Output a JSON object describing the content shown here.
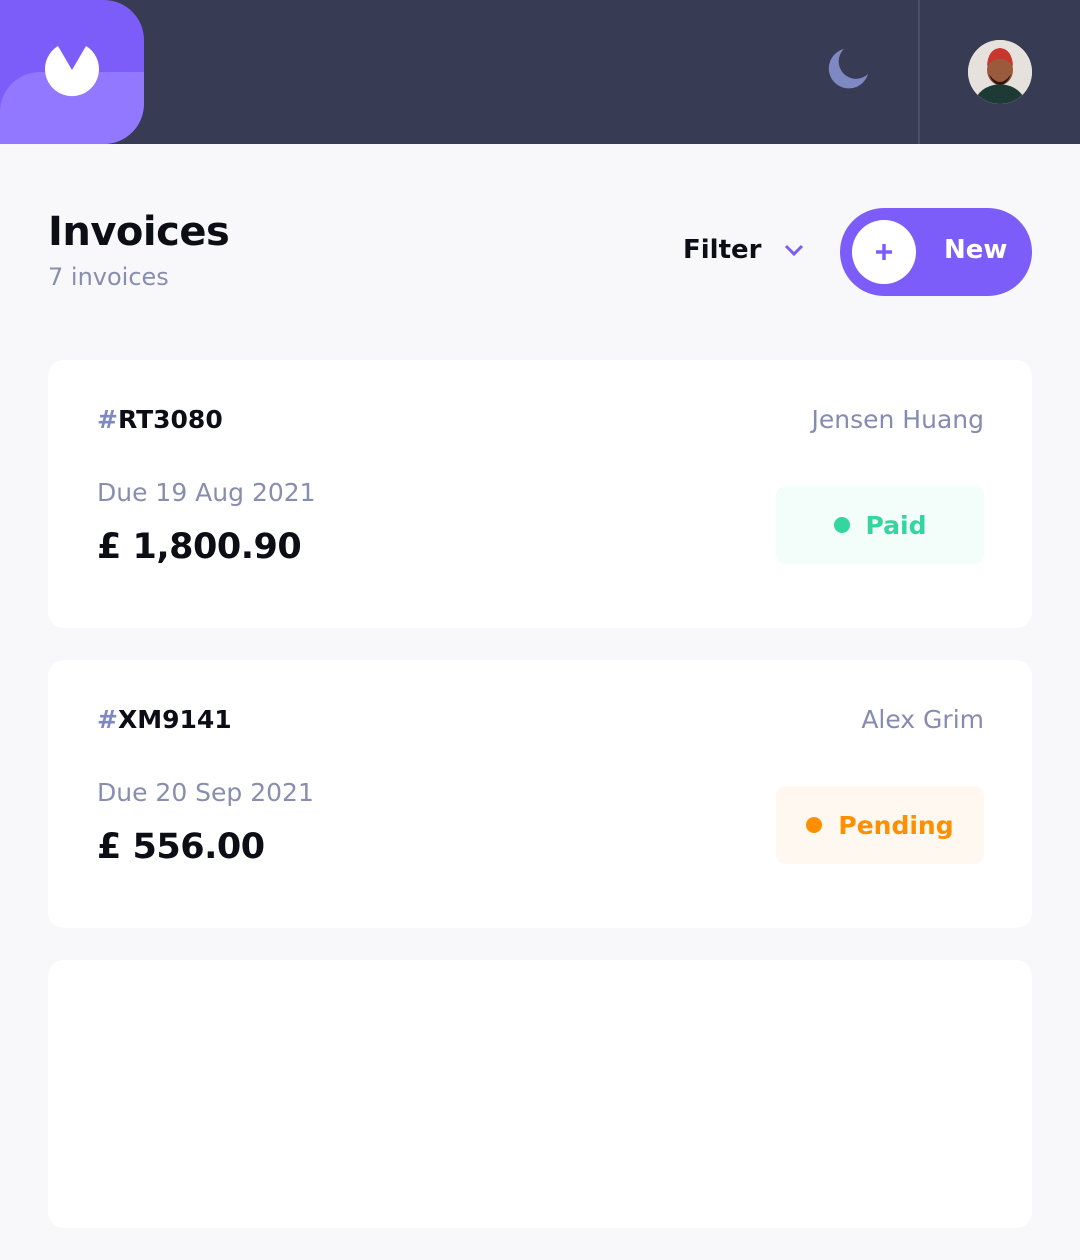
{
  "header": {
    "logo_icon": "app-logo-icon",
    "theme_toggle_icon": "moon-icon",
    "avatar_icon": "user-avatar"
  },
  "main": {
    "title": "Invoices",
    "count_text": "7 invoices",
    "filter_label": "Filter",
    "filter_icon": "chevron-down-icon",
    "new_button_label": "New",
    "new_button_icon": "plus-icon"
  },
  "invoices": [
    {
      "hash": "#",
      "id": "RT3080",
      "client": "Jensen Huang",
      "due": "Due 19 Aug 2021",
      "amount": "£ 1,800.90",
      "status": "Paid"
    },
    {
      "hash": "#",
      "id": "XM9141",
      "client": "Alex Grim",
      "due": "Due 20 Sep 2021",
      "amount": "£ 556.00",
      "status": "Pending"
    }
  ],
  "colors": {
    "accent": "#7C5DFA",
    "accent_light": "#9277FF",
    "header_bg": "#373B53",
    "page_bg": "#F8F8FB",
    "paid": "#33D69F",
    "pending": "#FF8F00"
  }
}
